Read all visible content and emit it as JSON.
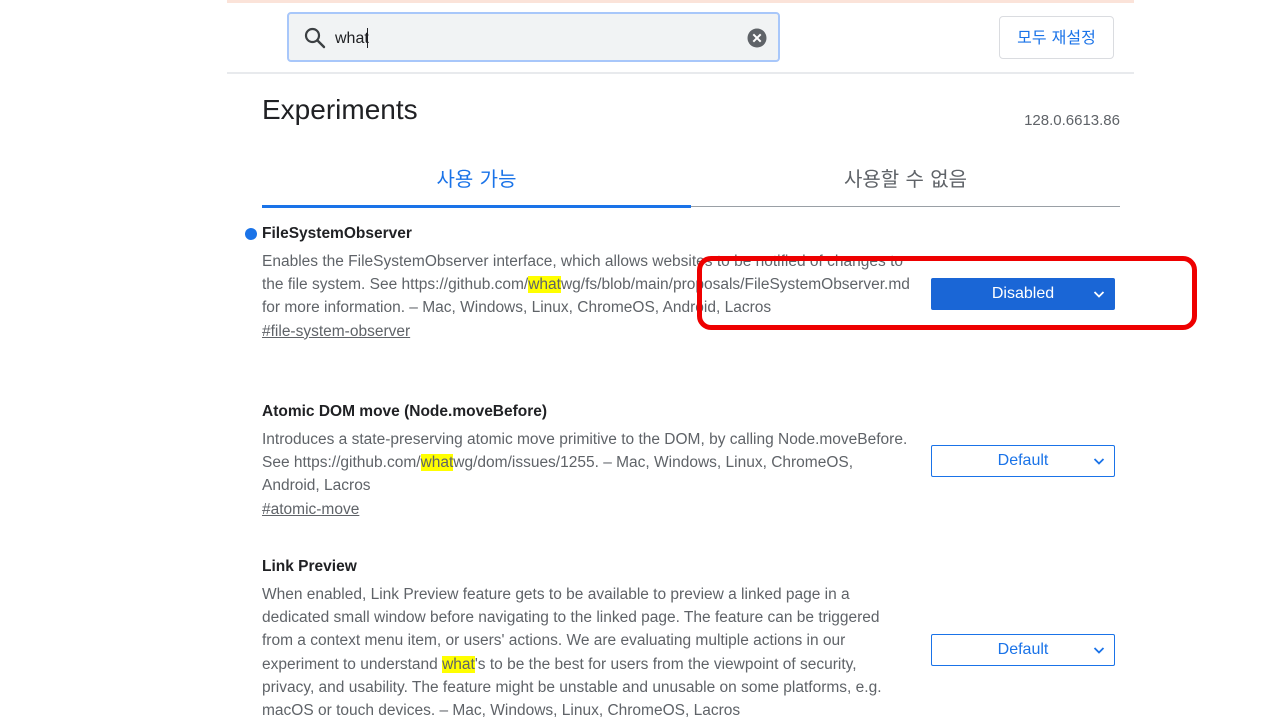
{
  "search": {
    "value": "what",
    "placeholder": ""
  },
  "header": {
    "reset_all_label": "모두 재설정",
    "title": "Experiments",
    "version": "128.0.6613.86"
  },
  "tabs": [
    {
      "label": "사용 가능",
      "active": true
    },
    {
      "label": "사용할 수 없음",
      "active": false
    }
  ],
  "experiments": [
    {
      "title": "FileSystemObserver",
      "is_new": true,
      "desc_before": "Enables the FileSystemObserver interface, which allows websites to be notified of changes to the file system. See https://github.com/",
      "desc_match": "what",
      "desc_after": "wg/fs/blob/main/proposals/FileSystemObserver.md for more information. – Mac, Windows, Linux, ChromeOS, Android, Lacros",
      "link": "#file-system-observer",
      "selected": "Disabled"
    },
    {
      "title": "Atomic DOM move (Node.moveBefore)",
      "is_new": false,
      "desc_before": "Introduces a state-preserving atomic move primitive to the DOM, by calling Node.moveBefore. See https://github.com/",
      "desc_match": "what",
      "desc_after": "wg/dom/issues/1255. – Mac, Windows, Linux, ChromeOS, Android, Lacros",
      "link": "#atomic-move",
      "selected": "Default"
    },
    {
      "title": "Link Preview",
      "is_new": false,
      "desc_before": "When enabled, Link Preview feature gets to be available to preview a linked page in a dedicated small window before navigating to the linked page. The feature can be triggered from a context menu item, or users' actions. We are evaluating multiple actions in our experiment to understand ",
      "desc_match": "what",
      "desc_after": "'s to be the best for users from the viewpoint of security, privacy, and usability. The feature might be unstable and unusable on some platforms, e.g. macOS or touch devices. – Mac, Windows, Linux, ChromeOS, Lacros",
      "link": "",
      "selected": "Default"
    }
  ],
  "colors": {
    "accent": "#1a73e8",
    "highlight": "#ffff00",
    "annotation": "#ee0000"
  },
  "icons": [
    "search-icon",
    "clear-icon",
    "chevron-down-icon"
  ]
}
